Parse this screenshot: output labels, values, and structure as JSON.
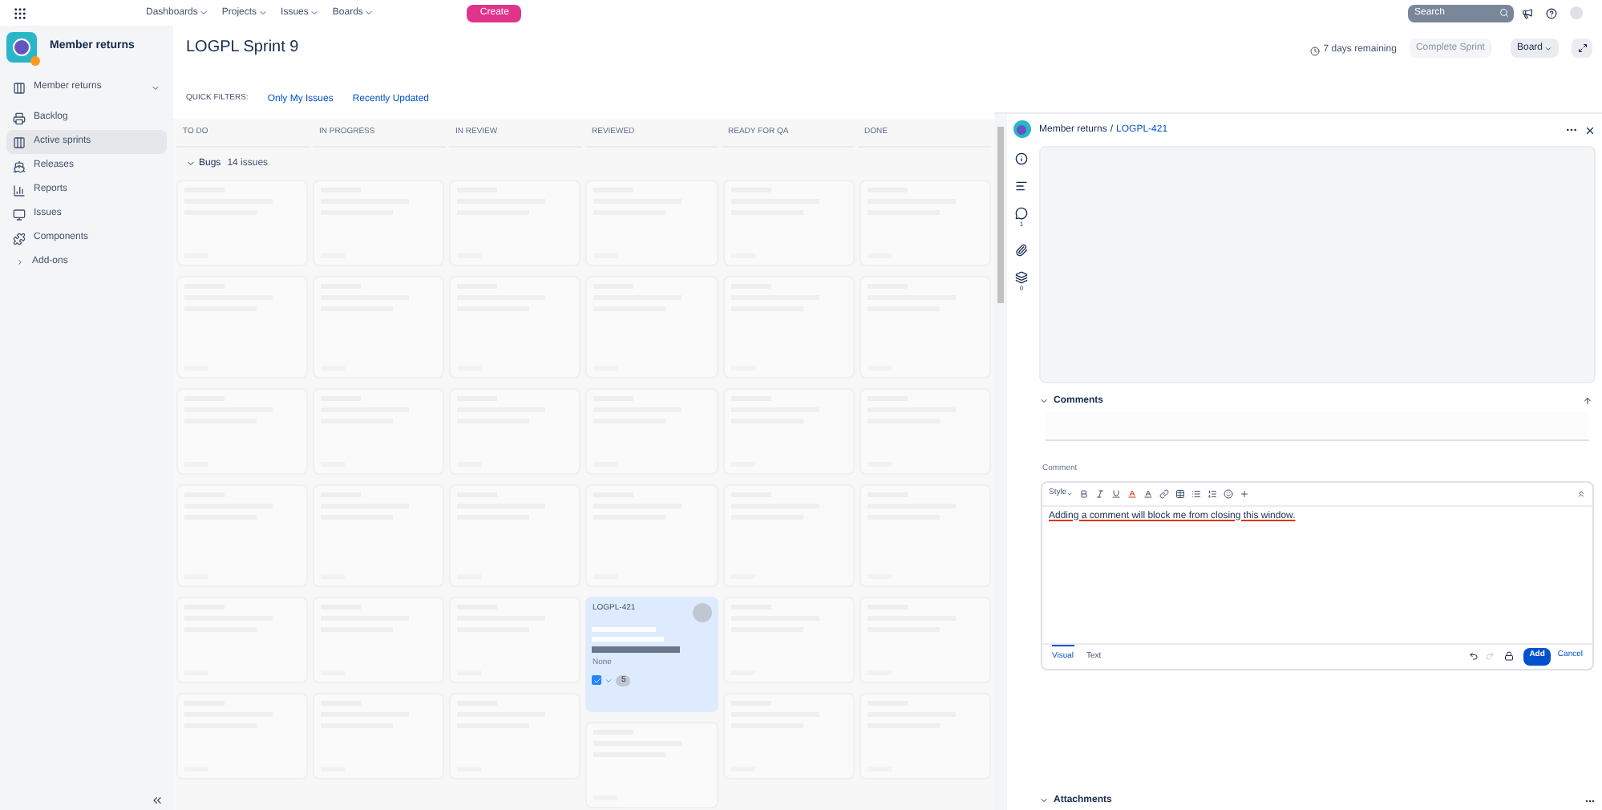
{
  "top_nav": {
    "menus": [
      {
        "label": "Dashboards"
      },
      {
        "label": "Projects"
      },
      {
        "label": "Issues"
      },
      {
        "label": "Boards"
      }
    ],
    "create": "Create",
    "search": {
      "placeholder": "Search"
    }
  },
  "sidebar": {
    "project": "Member returns",
    "items": [
      {
        "label": "Member returns",
        "kind": "dropdown",
        "selected": false
      },
      {
        "label": "Backlog",
        "kind": "link",
        "selected": false
      },
      {
        "label": "Active sprints",
        "kind": "link",
        "selected": true
      },
      {
        "label": "Releases",
        "kind": "link",
        "selected": false
      },
      {
        "label": "Reports",
        "kind": "link",
        "selected": false
      },
      {
        "label": "Issues",
        "kind": "link",
        "selected": false
      },
      {
        "label": "Components",
        "kind": "link",
        "selected": false
      },
      {
        "label": "Add-ons",
        "kind": "expander",
        "selected": false
      }
    ]
  },
  "board": {
    "title": "LOGPL Sprint 9",
    "remaining": "7 days remaining",
    "complete": {
      "label": "Complete Sprint",
      "disabled": true
    },
    "view": "Board",
    "quick_filters": {
      "label": "QUICK FILTERS:",
      "filters": [
        "Only My Issues",
        "Recently Updated"
      ]
    },
    "columns": [
      {
        "label": "TO DO"
      },
      {
        "label": "IN PROGRESS"
      },
      {
        "label": "IN REVIEW"
      },
      {
        "label": "REVIEWED",
        "selected_card": {
          "key": "LOGPL-421",
          "fix_version": "None",
          "estimate": "5",
          "checked": true
        }
      },
      {
        "label": "READY FOR QA"
      },
      {
        "label": "DONE"
      }
    ],
    "swimlane": {
      "name": "Bugs",
      "count": "14 issues",
      "expanded": true
    }
  },
  "detail": {
    "project": "Member returns",
    "separator": "/",
    "issue_key": "LOGPL-421",
    "comment_count": "1",
    "subtask_count": "0",
    "comments": {
      "title": "Comments",
      "expanded": true
    },
    "editor": {
      "label": "Comment",
      "style": "Style",
      "value": "Adding a comment will block me from closing this window.",
      "tabs": [
        {
          "label": "Visual",
          "selected": true
        },
        {
          "label": "Text",
          "selected": false
        }
      ],
      "add": "Add",
      "cancel": "Cancel"
    },
    "attachments": {
      "title": "Attachments",
      "expanded": true
    }
  }
}
